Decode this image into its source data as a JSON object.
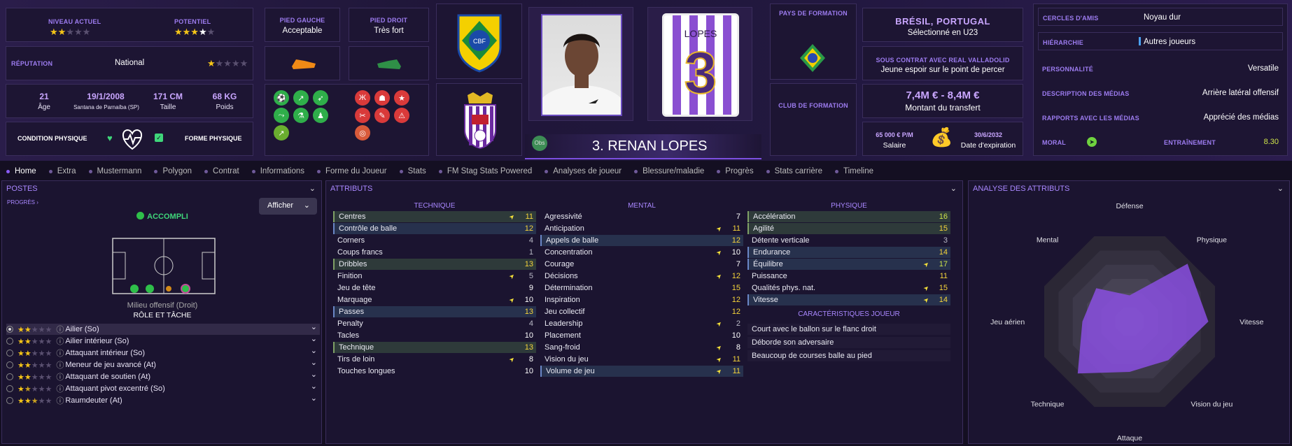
{
  "top": {
    "niveau_label": "NIVEAU ACTUEL",
    "potentiel_label": "POTENTIEL",
    "reputation_label": "RÉPUTATION",
    "reputation_value": "National",
    "age_value": "21",
    "age_label": "Âge",
    "birth_value": "19/1/2008",
    "birth_place": "Santana de Parnaíba (SP)",
    "height_value": "171 CM",
    "height_label": "Taille",
    "weight_value": "68 KG",
    "weight_label": "Poids",
    "condition_label": "CONDITION PHYSIQUE",
    "forme_label": "FORME PHYSIQUE",
    "pied_gauche_label": "PIED GAUCHE",
    "pied_gauche_value": "Acceptable",
    "pied_droit_label": "PIED DROIT",
    "pied_droit_value": "Très fort",
    "player_name": "3. RENAN LOPES",
    "obs": "Obs",
    "shirt_name": "LOPES",
    "shirt_number": "3",
    "pays_formation_label": "PAYS DE FORMATION",
    "club_formation_label": "CLUB DE FORMATION",
    "nationality": "BRÉSIL, PORTUGAL",
    "nationality_sub": "Sélectionné en U23",
    "contract_label": "SOUS CONTRAT AVEC REAL VALLADOLID",
    "contract_sub": "Jeune espoir sur le point de percer",
    "transfer_value": "7,4M € - 8,4M €",
    "transfer_label": "Montant du transfert",
    "salary_value": "65 000 € P/M",
    "salary_label": "Salaire",
    "expiry_value": "30/6/2032",
    "expiry_label": "Date d'expiration",
    "cercles_label": "CERCLES D'AMIS",
    "cercles_value": "Noyau dur",
    "hierarchie_label": "HIÉRARCHIE",
    "hierarchie_value": "Autres joueurs",
    "personnalite_label": "PERSONNALITÉ",
    "personnalite_value": "Versatile",
    "desc_medias_label": "DESCRIPTION DES MÉDIAS",
    "desc_medias_value": "Arrière latéral offensif",
    "rapports_label": "RAPPORTS AVEC LES MÉDIAS",
    "rapports_value": "Apprécié des médias",
    "moral_label": "MORAL",
    "entrainement_label": "ENTRAÎNEMENT",
    "entrainement_value": "8.30",
    "colors": {
      "accent": "#9d7cf0",
      "gold": "#f5c518"
    }
  },
  "tabs": [
    "Home",
    "Extra",
    "Mustermann",
    "Polygon",
    "Contrat",
    "Informations",
    "Forme du Joueur",
    "Stats",
    "FM Stag Stats Powered",
    "Analyses de joueur",
    "Blessure/maladie",
    "Progrès",
    "Stats carrière",
    "Timeline"
  ],
  "postes": {
    "title": "POSTES",
    "progres": "PROGRÈS",
    "afficher": "Afficher",
    "accompli": "ACCOMPLI",
    "position": "Milieu offensif (Droit)",
    "role_title": "RÔLE ET TÂCHE",
    "roles": [
      "Ailier (So)",
      "Ailier intérieur (So)",
      "Attaquant intérieur (So)",
      "Meneur de jeu avancé (At)",
      "Attaquant de soutien (At)",
      "Attaquant pivot excentré (So)",
      "Raumdeuter (At)"
    ]
  },
  "attributs": {
    "title": "ATTRIBUTS",
    "technique_title": "TECHNIQUE",
    "mental_title": "MENTAL",
    "physique_title": "PHYSIQUE",
    "technique": [
      [
        "Centres",
        "11"
      ],
      [
        "Contrôle de balle",
        "12"
      ],
      [
        "Corners",
        "4"
      ],
      [
        "Coups francs",
        "1"
      ],
      [
        "Dribbles",
        "13"
      ],
      [
        "Finition",
        "5"
      ],
      [
        "Jeu de tête",
        "9"
      ],
      [
        "Marquage",
        "10"
      ],
      [
        "Passes",
        "13"
      ],
      [
        "Penalty",
        "4"
      ],
      [
        "Tacles",
        "10"
      ],
      [
        "Technique",
        "13"
      ],
      [
        "Tirs de loin",
        "8"
      ],
      [
        "Touches longues",
        "10"
      ]
    ],
    "mental": [
      [
        "Agressivité",
        "7"
      ],
      [
        "Anticipation",
        "11"
      ],
      [
        "Appels de balle",
        "12"
      ],
      [
        "Concentration",
        "10"
      ],
      [
        "Courage",
        "7"
      ],
      [
        "Décisions",
        "12"
      ],
      [
        "Détermination",
        "15"
      ],
      [
        "Inspiration",
        "12"
      ],
      [
        "Jeu collectif",
        "12"
      ],
      [
        "Leadership",
        "2"
      ],
      [
        "Placement",
        "10"
      ],
      [
        "Sang-froid",
        "8"
      ],
      [
        "Vision du jeu",
        "11"
      ],
      [
        "Volume de jeu",
        "11"
      ]
    ],
    "physique": [
      [
        "Accélération",
        "16"
      ],
      [
        "Agilité",
        "15"
      ],
      [
        "Détente verticale",
        "3"
      ],
      [
        "Endurance",
        "14"
      ],
      [
        "Équilibre",
        "17"
      ],
      [
        "Puissance",
        "11"
      ],
      [
        "Qualités phys. nat.",
        "15"
      ],
      [
        "Vitesse",
        "14"
      ]
    ],
    "carac_title": "CARACTÉRISTIQUES JOUEUR",
    "carac": [
      "Court avec le ballon sur le flanc droit",
      "Déborde son adversaire",
      "Beaucoup de courses balle au pied"
    ]
  },
  "analyse": {
    "title": "ANALYSE DES ATTRIBUTS",
    "labels": [
      "Défense",
      "Physique",
      "Vitesse",
      "Vision du jeu",
      "Attaque",
      "Technique",
      "Jeu aérien",
      "Mental"
    ]
  }
}
